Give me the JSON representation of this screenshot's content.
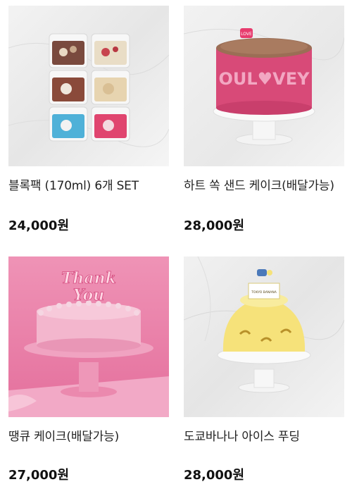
{
  "products": [
    {
      "name": "블록팩 (170ml) 6개 SET",
      "price": "24,000원"
    },
    {
      "name": "하트 쏙 샌드 케이크(배달가능)",
      "price": "28,000원"
    },
    {
      "name": "땡큐 케이크(배달가능)",
      "price": "27,000원"
    },
    {
      "name": "도쿄바나나 아이스 푸딩",
      "price": "28,000원"
    }
  ],
  "images": {
    "cake_topper_love": "LOVE",
    "cake_band_text": "OUL♥VEY",
    "thank_you_topper_line1": "Thank",
    "thank_you_topper_line2": "You",
    "tokyo_banana_label": "TOKYO BANANA"
  },
  "colors": {
    "pink_bg": "#ea7fa7",
    "marble_bg": "#eeeeee"
  }
}
